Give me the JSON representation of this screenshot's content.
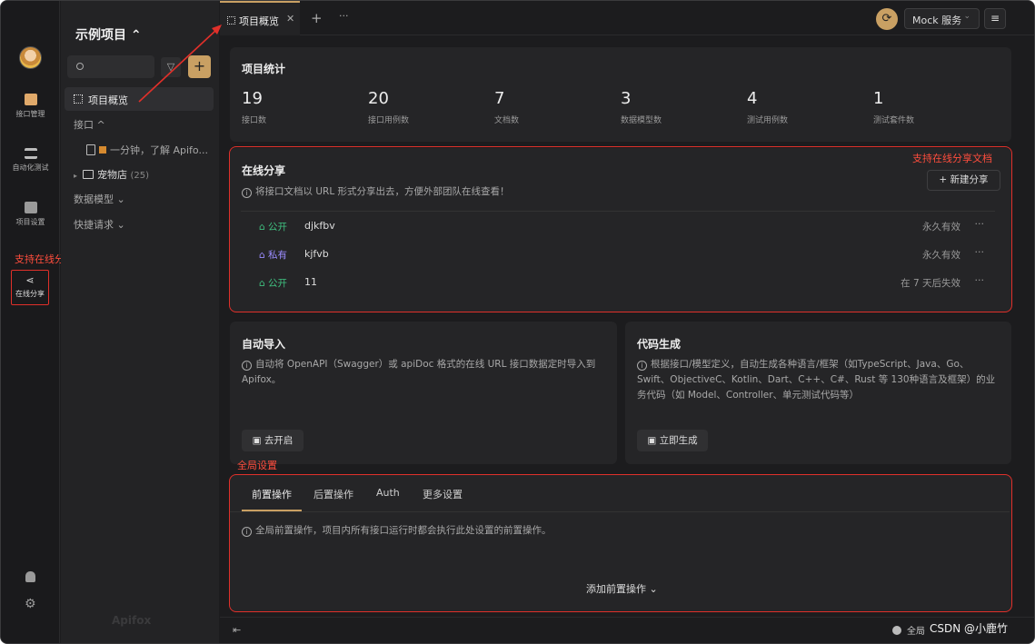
{
  "window": {
    "lights": [
      "close",
      "minimize",
      "zoom"
    ]
  },
  "rail": {
    "items": [
      {
        "label": "接口管理",
        "icon": "api-icon"
      },
      {
        "label": "自动化测试",
        "icon": "automation-icon"
      },
      {
        "label": "项目设置",
        "icon": "settings-icon"
      },
      {
        "label": "在线分享",
        "icon": "share-icon"
      }
    ],
    "annotation": "支持在线分享文档"
  },
  "sidebar": {
    "project_title": "示例项目 ⌃",
    "nav_overview": "项目概览",
    "tree": {
      "api_section": "接口 ^",
      "doc_item": "一分钟，了解 Apifo...",
      "folder_item": "宠物店",
      "folder_count": "(25)",
      "data_models": "数据模型 ⌄",
      "quick_requests": "快捷请求 ⌄"
    },
    "logo_text": "Apifox"
  },
  "tabbar": {
    "active_tab": "项目概览",
    "close": "✕",
    "plus": "+",
    "more": "···",
    "mock_label": "Mock 服务",
    "mock_chevron": "⌄"
  },
  "stats": {
    "title": "项目统计",
    "items": [
      {
        "value": "19",
        "label": "接口数"
      },
      {
        "value": "20",
        "label": "接口用例数"
      },
      {
        "value": "7",
        "label": "文档数"
      },
      {
        "value": "3",
        "label": "数据模型数"
      },
      {
        "value": "4",
        "label": "测试用例数"
      },
      {
        "value": "1",
        "label": "测试套件数"
      }
    ]
  },
  "share": {
    "title": "在线分享",
    "description": "将接口文档以 URL 形式分享出去，方便外部团队在线查看！",
    "new_button": "+ 新建分享",
    "annotation": "支持在线分享文档",
    "rows": [
      {
        "tag": "公开",
        "tag_type": "public",
        "name": "djkfbv",
        "expiry": "永久有效"
      },
      {
        "tag": "私有",
        "tag_type": "private",
        "name": "kjfvb",
        "expiry": "永久有效"
      },
      {
        "tag": "公开",
        "tag_type": "public",
        "name": "11",
        "expiry": "在 7 天后失效"
      }
    ],
    "row_menu": "···"
  },
  "auto_import": {
    "title": "自动导入",
    "description": "自动将 OpenAPI（Swagger）或 apiDoc 格式的在线 URL 接口数据定时导入到 Apifox。",
    "button": "去开启"
  },
  "codegen": {
    "title": "代码生成",
    "description": "根据接口/模型定义，自动生成各种语言/框架（如TypeScript、Java、Go、Swift、ObjectiveC、Kotlin、Dart、C++、C#、Rust 等 130种语言及框架）的业务代码（如 Model、Controller、单元测试代码等）",
    "button": "立即生成"
  },
  "global": {
    "annotation": "全局设置",
    "tabs": [
      "前置操作",
      "后置操作",
      "Auth",
      "更多设置"
    ],
    "description": "全局前置操作，项目内所有接口运行时都会执行此处设置的前置操作。",
    "add_button": "添加前置操作 ⌄"
  },
  "footer": {
    "right_text": "全局",
    "watermark": "CSDN @小鹿竹"
  },
  "colors": {
    "accent": "#c9a063",
    "annotation_red": "#e0302a",
    "public_tag": "#3fbf7f",
    "private_tag": "#9b8cff"
  }
}
